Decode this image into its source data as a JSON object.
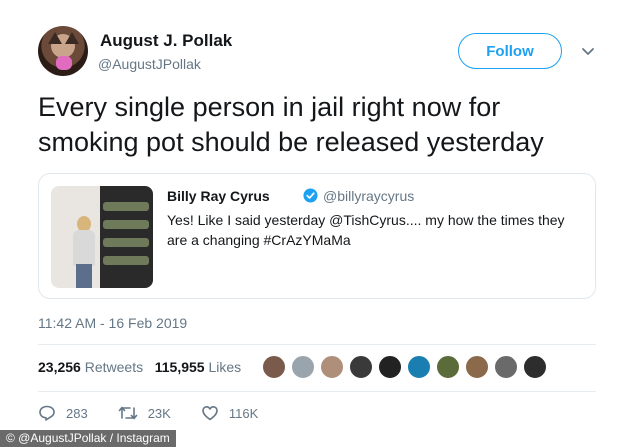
{
  "author": {
    "display_name": "August J. Pollak",
    "handle": "@AugustJPollak"
  },
  "follow_label": "Follow",
  "tweet_text": "Every single person in jail right now for smoking pot should be released yesterday",
  "quoted": {
    "display_name": "Billy Ray Cyrus",
    "handle": "@billyraycyrus",
    "text": "Yes! Like I said yesterday @TishCyrus.... my how the times they are a changing #CrAzYMaMa"
  },
  "timestamp": "11:42 AM - 16 Feb 2019",
  "stats": {
    "retweets_count": "23,256",
    "retweets_label": "Retweets",
    "likes_count": "115,955",
    "likes_label": "Likes"
  },
  "liker_avatar_colors": [
    "#7a5a4a",
    "#9aa4ad",
    "#b08f7a",
    "#3a3a3a",
    "#222222",
    "#1a7fb0",
    "#5c6b3a",
    "#8a6a4a",
    "#6a6a6a",
    "#2d2d2d"
  ],
  "actions": {
    "replies": "283",
    "retweets": "23K",
    "likes": "116K"
  },
  "watermark": "© @AugustJPollak / Instagram",
  "colors": {
    "accent": "#1da1f2",
    "text": "#14171a",
    "secondary": "#657786",
    "border": "#e1e8ed"
  }
}
